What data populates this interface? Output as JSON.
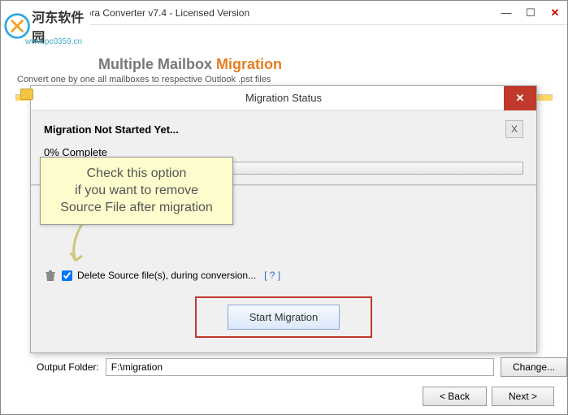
{
  "window": {
    "title": "SoftSpire Zimbra Converter v7.4 - Licensed Version",
    "logo_text": "河东软件园",
    "logo_sub": "www.pc0359.cn"
  },
  "header": {
    "h1_prefix": "Multiple Mailbox ",
    "h1_colored": "Migration",
    "sub": "Convert one by one all mailboxes to respective Outlook .pst files"
  },
  "dialog": {
    "title": "Migration Status",
    "status": "Migration Not Started Yet...",
    "percent": "0% Complete",
    "delete_label": "Delete Source file(s), during conversion...",
    "delete_checked": true,
    "help": "[ ? ]",
    "start_button": "Start Migration",
    "cancel_x": "X"
  },
  "callout": {
    "line1": "Check this option",
    "line2": "if you want to remove",
    "line3": "Source File after migration"
  },
  "output": {
    "label": "Output Folder:",
    "value": "F:\\migration",
    "change": "Change..."
  },
  "nav": {
    "back": "< Back",
    "next": "Next >"
  }
}
